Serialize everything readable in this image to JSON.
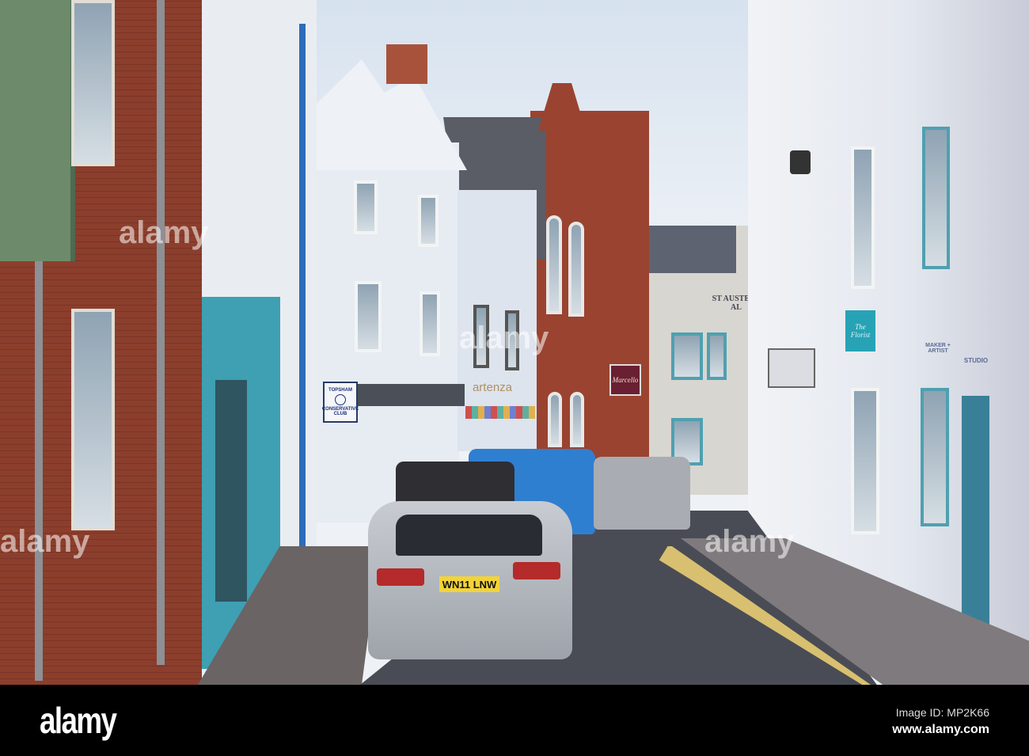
{
  "signs": {
    "club_top": "TOPSHAM",
    "club_bottom": "CONSERVATIVE CLUB",
    "restaurant": "Marcello",
    "pub": "ST AUSTELL AL",
    "shop_teal": "The Florist",
    "maker": "MAKER + ARTIST",
    "studio": "STUDIO",
    "cafe": "artenza"
  },
  "car": {
    "plate": "WN11 LNW"
  },
  "watermark": {
    "logo": "alamy",
    "image_id": "Image ID: MP2K66",
    "url": "www.alamy.com"
  },
  "colors": {
    "brick": "#8c3e2c",
    "teal": "#3f9fb3",
    "sky": "#dfe7f0",
    "road": "#4a4c55"
  }
}
